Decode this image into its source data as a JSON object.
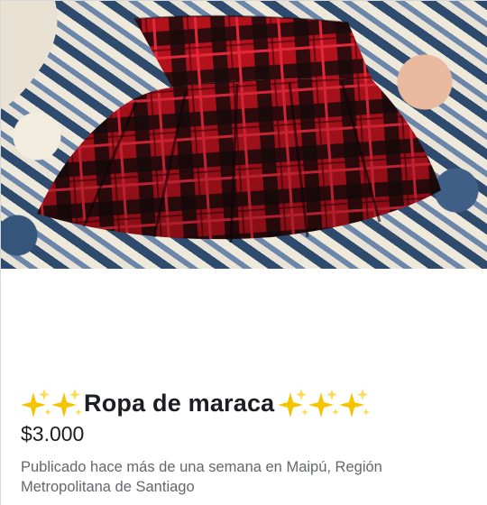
{
  "listing": {
    "image": {
      "subject": "red and black plaid pleated skirt",
      "icon": "product-photo",
      "colors": {
        "plaid_red": "#c4141f",
        "plaid_black": "#1a0a0c",
        "background_blue": "#3a567a"
      }
    },
    "title": "Ropa de maraca",
    "title_decoration_icon": "sparkles-emoji",
    "leading_sparkles": 2,
    "trailing_sparkles": 3,
    "price": "$3.000",
    "location_text": "Publicado hace más de una semana en Maipú, Región Metropolitana de Santiago",
    "colors": {
      "title": "#1c1e21",
      "secondary_text": "#65676b",
      "sparkle_gold": "#f5c400"
    }
  }
}
